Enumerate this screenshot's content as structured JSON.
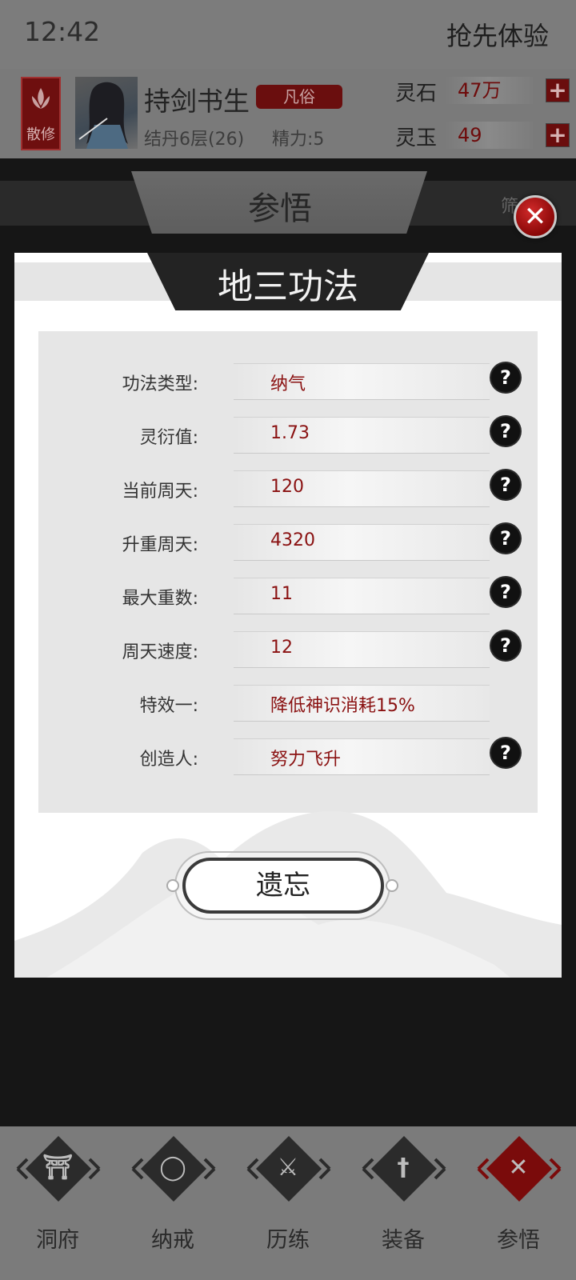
{
  "status_bar": {
    "time": "12:42",
    "early_access": "抢先体验"
  },
  "player": {
    "sect": "散修",
    "name": "持剑书生",
    "rank": "凡俗",
    "realm": "结丹6层(26)",
    "energy": "精力:5",
    "currencies": [
      {
        "label": "灵石",
        "value": "47万"
      },
      {
        "label": "灵玉",
        "value": "49"
      }
    ]
  },
  "section": {
    "title": "参悟",
    "filter": "筛"
  },
  "modal": {
    "title": "地三功法",
    "properties": [
      {
        "label": "功法类型:",
        "value": "纳气",
        "help": true
      },
      {
        "label": "灵衍值:",
        "value": "1.73",
        "help": true
      },
      {
        "label": "当前周天:",
        "value": "120",
        "help": true
      },
      {
        "label": "升重周天:",
        "value": "4320",
        "help": true
      },
      {
        "label": "最大重数:",
        "value": "11",
        "help": true
      },
      {
        "label": "周天速度:",
        "value": "12",
        "help": true
      },
      {
        "label": "特效一:",
        "value": "降低神识消耗15%",
        "help": false
      },
      {
        "label": "创造人:",
        "value": "努力飞升",
        "help": true
      }
    ],
    "forget_label": "遗忘",
    "close_glyph": "✕",
    "help_glyph": "?"
  },
  "nav": [
    {
      "label": "洞府",
      "icon": "gate-icon",
      "glyph": "⛩",
      "active": false
    },
    {
      "label": "纳戒",
      "icon": "ring-icon",
      "glyph": "◯",
      "active": false
    },
    {
      "label": "历练",
      "icon": "crossed-swords-icon",
      "glyph": "⚔",
      "active": false
    },
    {
      "label": "装备",
      "icon": "sword-icon",
      "glyph": "†",
      "active": false
    },
    {
      "label": "参悟",
      "icon": "close-x-icon",
      "glyph": "✕",
      "active": true
    }
  ],
  "colors": {
    "accent_red": "#8a1111",
    "dark_red": "#6a0d0d",
    "overlay_gray": "#7b7b7b"
  }
}
